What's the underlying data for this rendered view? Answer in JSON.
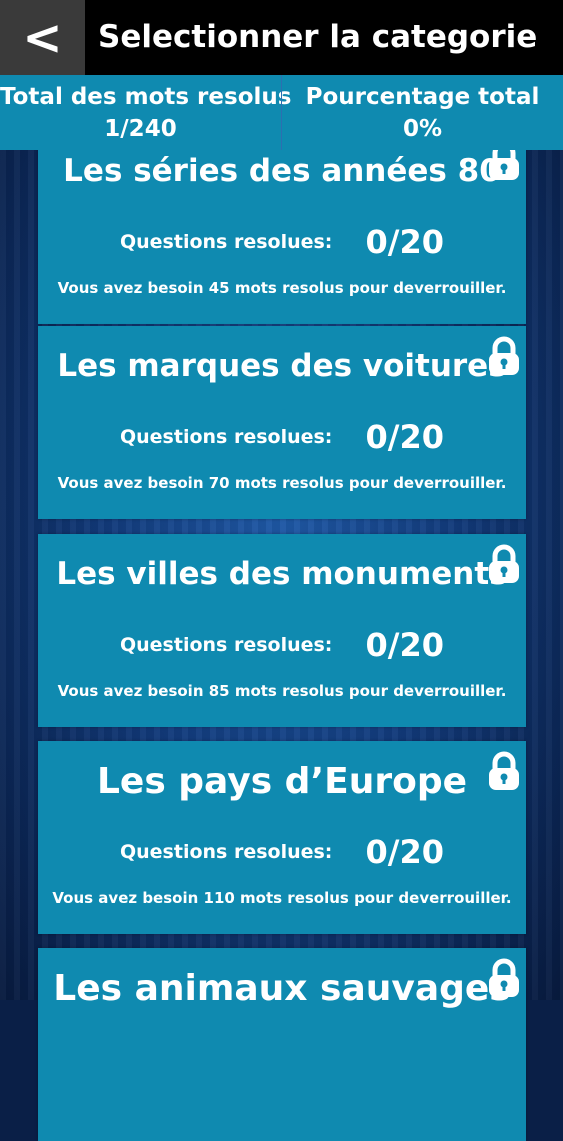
{
  "header": {
    "back_label": "<",
    "title": "Selectionner la categorie"
  },
  "stats": {
    "words_label": "Total des mots resolus",
    "words_value": "1/240",
    "percent_label": "Pourcentage total",
    "percent_value": "0%"
  },
  "categories": [
    {
      "title": "Les séries des années 80",
      "questions_label": "Questions resolues:",
      "questions_value": "0/20",
      "unlock_text": "Vous avez besoin 45 mots resolus pour deverrouiller.",
      "icon": "lock-icon"
    },
    {
      "title": "Les marques des voitures",
      "questions_label": "Questions resolues:",
      "questions_value": "0/20",
      "unlock_text": "Vous avez besoin 70 mots resolus pour deverrouiller.",
      "icon": "lock-icon"
    },
    {
      "title": "Les villes des monuments",
      "questions_label": "Questions resolues:",
      "questions_value": "0/20",
      "unlock_text": "Vous avez besoin 85 mots resolus pour deverrouiller.",
      "icon": "lock-icon"
    },
    {
      "title": "Les pays d’Europe",
      "questions_label": "Questions resolues:",
      "questions_value": "0/20",
      "unlock_text": "Vous avez besoin 110 mots resolus pour deverrouiller.",
      "icon": "lock-icon"
    },
    {
      "title": "Les animaux sauvages",
      "icon": "lock-icon"
    }
  ],
  "colors": {
    "card": "#0f8ab0",
    "topbar": "#000000",
    "back_button": "#3a3a3a",
    "text": "#ffffff"
  }
}
